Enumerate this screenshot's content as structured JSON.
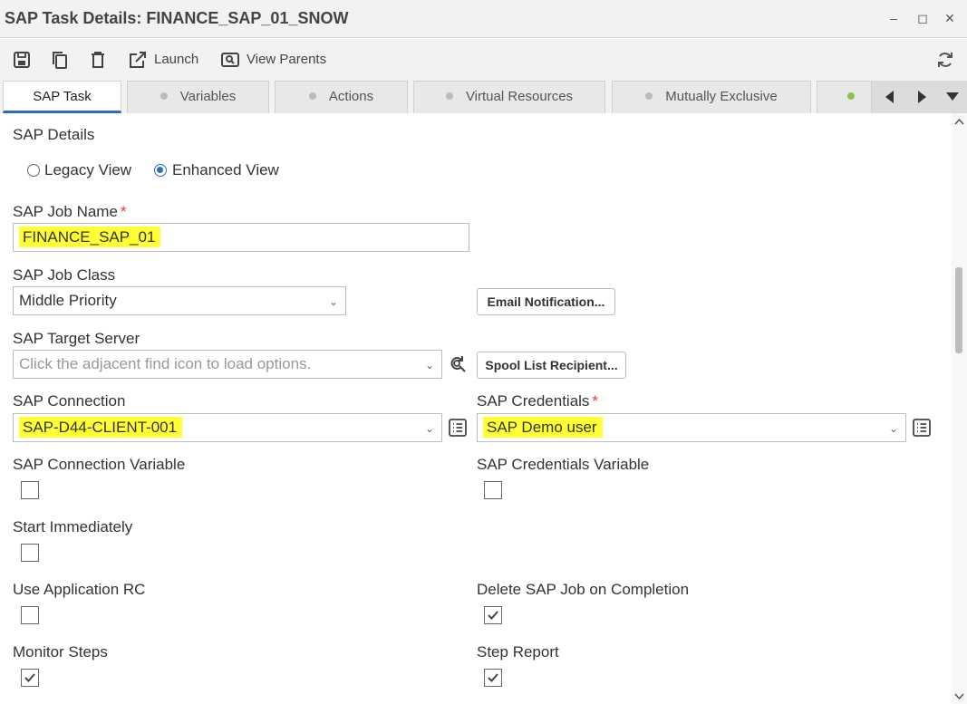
{
  "window": {
    "title": "SAP Task Details: FINANCE_SAP_01_SNOW",
    "minimize": "–",
    "maximize": "◻",
    "close": "✕"
  },
  "toolbar": {
    "launch_label": "Launch",
    "view_parents_label": "View Parents"
  },
  "tabs": [
    {
      "label": "SAP Task"
    },
    {
      "label": "Variables"
    },
    {
      "label": "Actions"
    },
    {
      "label": "Virtual Resources"
    },
    {
      "label": "Mutually Exclusive"
    }
  ],
  "form": {
    "section_title": "SAP Details",
    "view_mode": {
      "legacy_label": "Legacy View",
      "enhanced_label": "Enhanced View",
      "selected": "Enhanced View"
    },
    "job_name": {
      "label": "SAP Job Name",
      "required": "*",
      "value": "FINANCE_SAP_01"
    },
    "job_class": {
      "label": "SAP Job Class",
      "value": "Middle Priority"
    },
    "email_button": "Email Notification...",
    "target_server": {
      "label": "SAP Target Server",
      "placeholder": "Click the adjacent find icon to load options."
    },
    "spool_button": "Spool List Recipient...",
    "connection": {
      "label": "SAP Connection",
      "value": "SAP-D44-CLIENT-001"
    },
    "credentials": {
      "label": "SAP Credentials",
      "required": "*",
      "value": "SAP Demo user"
    },
    "connection_variable": {
      "label": "SAP Connection Variable",
      "checked": false
    },
    "credentials_variable": {
      "label": "SAP Credentials Variable",
      "checked": false
    },
    "start_immediately": {
      "label": "Start Immediately",
      "checked": false
    },
    "use_app_rc": {
      "label": "Use Application RC",
      "checked": false
    },
    "delete_on_completion": {
      "label": "Delete SAP Job on Completion",
      "checked": true
    },
    "monitor_steps": {
      "label": "Monitor Steps",
      "checked": true
    },
    "step_report": {
      "label": "Step Report",
      "checked": true
    }
  },
  "colors": {
    "highlight": "#ffff33",
    "accent": "#2d6fb7",
    "required": "#e53935"
  }
}
